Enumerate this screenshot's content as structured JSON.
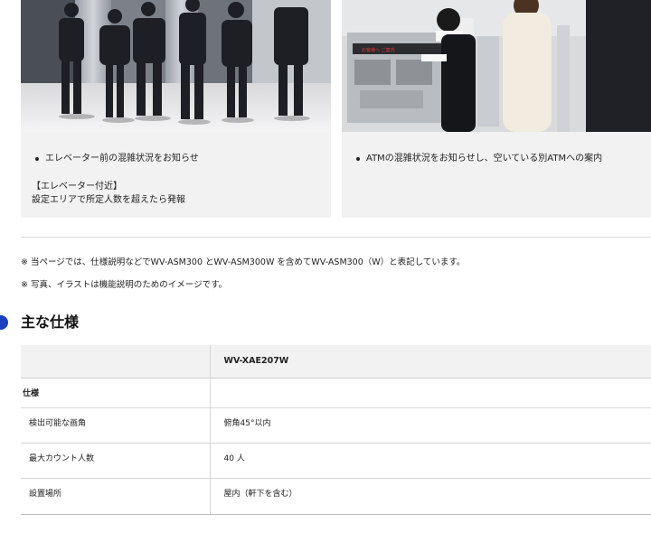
{
  "cards": [
    {
      "bullet": "エレベーター前の混雑状況をお知らせ",
      "sub_heading": "【エレベーター付近】",
      "sub_text": "設定エリアで所定人数を超えたら発報"
    },
    {
      "bullet": "ATMの混雑状況をお知らせし、空いている別ATMへの案内",
      "atm_display": "お客様へ ご案内"
    }
  ],
  "notes": [
    "※ 当ページでは、仕様説明などでWV-ASM300 とWV-ASM300W を含めてWV-ASM300（W）と表記しています。",
    "※ 写真、イラストは機能説明のためのイメージです。"
  ],
  "spec": {
    "title": "主な仕様",
    "model_header": "WV-XAE207W",
    "category": "仕様",
    "rows": [
      {
        "label": "検出可能な画角",
        "value": "俯角45°以内"
      },
      {
        "label": "最大カウント人数",
        "value": "40 人"
      },
      {
        "label": "設置場所",
        "value": "屋内（軒下を含む）"
      }
    ]
  },
  "colors": {
    "accent_dot": "#1a3fbf",
    "card_bg": "#f2f2f2"
  }
}
